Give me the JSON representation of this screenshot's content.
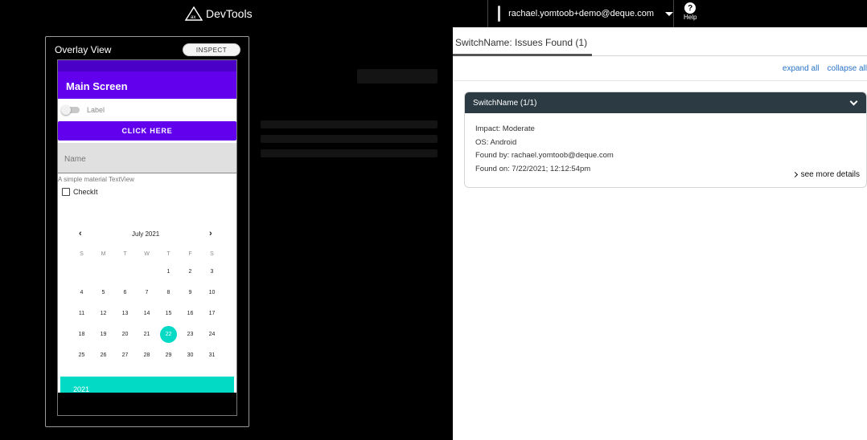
{
  "header": {
    "brand": "DevTools",
    "user_email": "rachael.yomtoob+demo@deque.com",
    "help_label": "Help"
  },
  "overlay": {
    "title": "Overlay View",
    "inspect_label": "INSPECT",
    "app_title": "Main Screen",
    "switch_label": "Label",
    "click_button": "CLICK HERE",
    "name_placeholder": "Name",
    "helper_text": "A simple material TextView",
    "checkbox_label": "CheckIt",
    "calendar": {
      "month": "July 2021",
      "prev": "‹",
      "next": "›",
      "weekdays": [
        "S",
        "M",
        "T",
        "W",
        "T",
        "F",
        "S"
      ],
      "weeks": [
        [
          "",
          "",
          "",
          "",
          "1",
          "2",
          "3"
        ],
        [
          "4",
          "5",
          "6",
          "7",
          "8",
          "9",
          "10"
        ],
        [
          "11",
          "12",
          "13",
          "14",
          "15",
          "16",
          "17"
        ],
        [
          "18",
          "19",
          "20",
          "21",
          "22",
          "23",
          "24"
        ],
        [
          "25",
          "26",
          "27",
          "28",
          "29",
          "30",
          "31"
        ]
      ],
      "selected": "22",
      "year": "2021"
    }
  },
  "panel": {
    "tab_label": "SwitchName: Issues Found (1)",
    "expand_all": "expand all",
    "collapse_all": "collapse all",
    "issue": {
      "title": "SwitchName (1/1)",
      "impact": "Impact: Moderate",
      "os": "OS: Android",
      "found_by": "Found by: rachael.yomtoob@deque.com",
      "found_on": "Found on: 7/22/2021; 12:12:54pm",
      "more_details": "see more details"
    }
  },
  "colors": {
    "primary": "#6200ee",
    "accent": "#03dac5",
    "header_bg": "#000000",
    "card_head": "#2c3a43",
    "link": "#2a74c7"
  }
}
